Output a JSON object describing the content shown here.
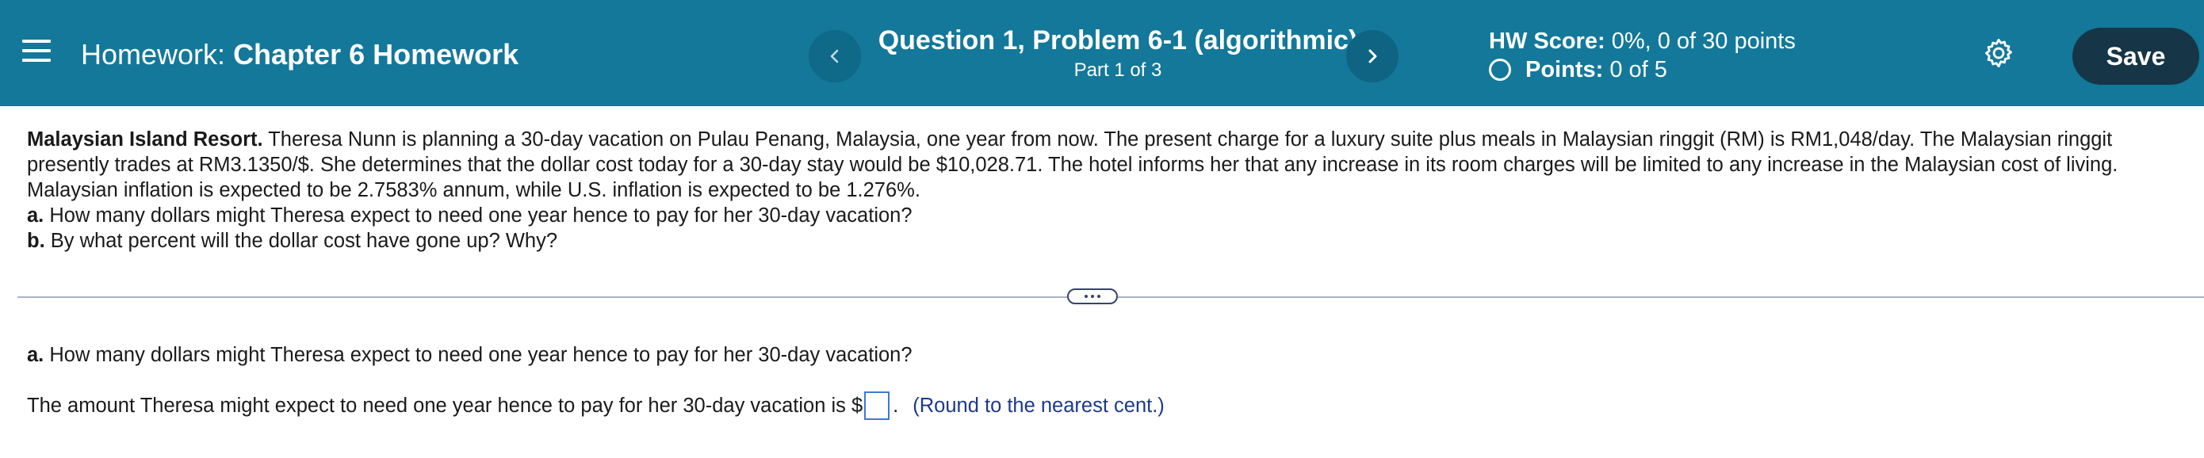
{
  "header": {
    "menu_icon": "hamburger-menu-icon",
    "hw_prefix": "Homework:",
    "hw_name": "Chapter 6 Homework",
    "question_title": "Question 1, Problem 6-1 (algorithmic)",
    "part": "Part 1 of 3",
    "prev_icon": "chevron-left-icon",
    "next_icon": "chevron-right-icon",
    "score_label": "HW Score:",
    "score_value": "0%, 0 of 30 points",
    "points_label": "Points:",
    "points_value": "0 of 5",
    "settings_icon": "gear-icon",
    "save_label": "Save",
    "colors": {
      "bar": "#13789a",
      "save_button": "#163547",
      "nav_button": "#0e6482"
    }
  },
  "problem": {
    "title": "Malaysian Island Resort.",
    "line1": " Theresa Nunn is planning a 30-day vacation on Pulau Penang, Malaysia, one year from now. The present charge for a luxury suite plus meals in Malaysian ringgit (RM) is RM1,048/day. The Malaysian ringgit",
    "line2": "presently trades at RM3.1350/$. She determines that the dollar cost today for a 30-day stay would be $10,028.71. The hotel informs her that any increase in its room charges will be limited to any increase in the Malaysian cost of living.",
    "line3": "Malaysian inflation is expected to be 2.7583% annum, while U.S. inflation is expected to be 1.276%.",
    "qa_label": "a.",
    "qa_text": " How many dollars might Theresa expect to need one year hence to pay for her 30-day vacation?",
    "qb_label": "b.",
    "qb_text": " By what percent will the dollar cost have gone up? Why?"
  },
  "divider": {
    "expand_icon": "ellipsis-icon"
  },
  "part_a": {
    "label": "a.",
    "text": " How many dollars might Theresa expect to need one year hence to pay for her 30-day vacation?",
    "answer_prefix": "The amount Theresa might expect to need one year hence to pay for her 30-day vacation is $",
    "answer_value": "",
    "answer_suffix": ".",
    "hint": "(Round to the nearest cent.)"
  }
}
